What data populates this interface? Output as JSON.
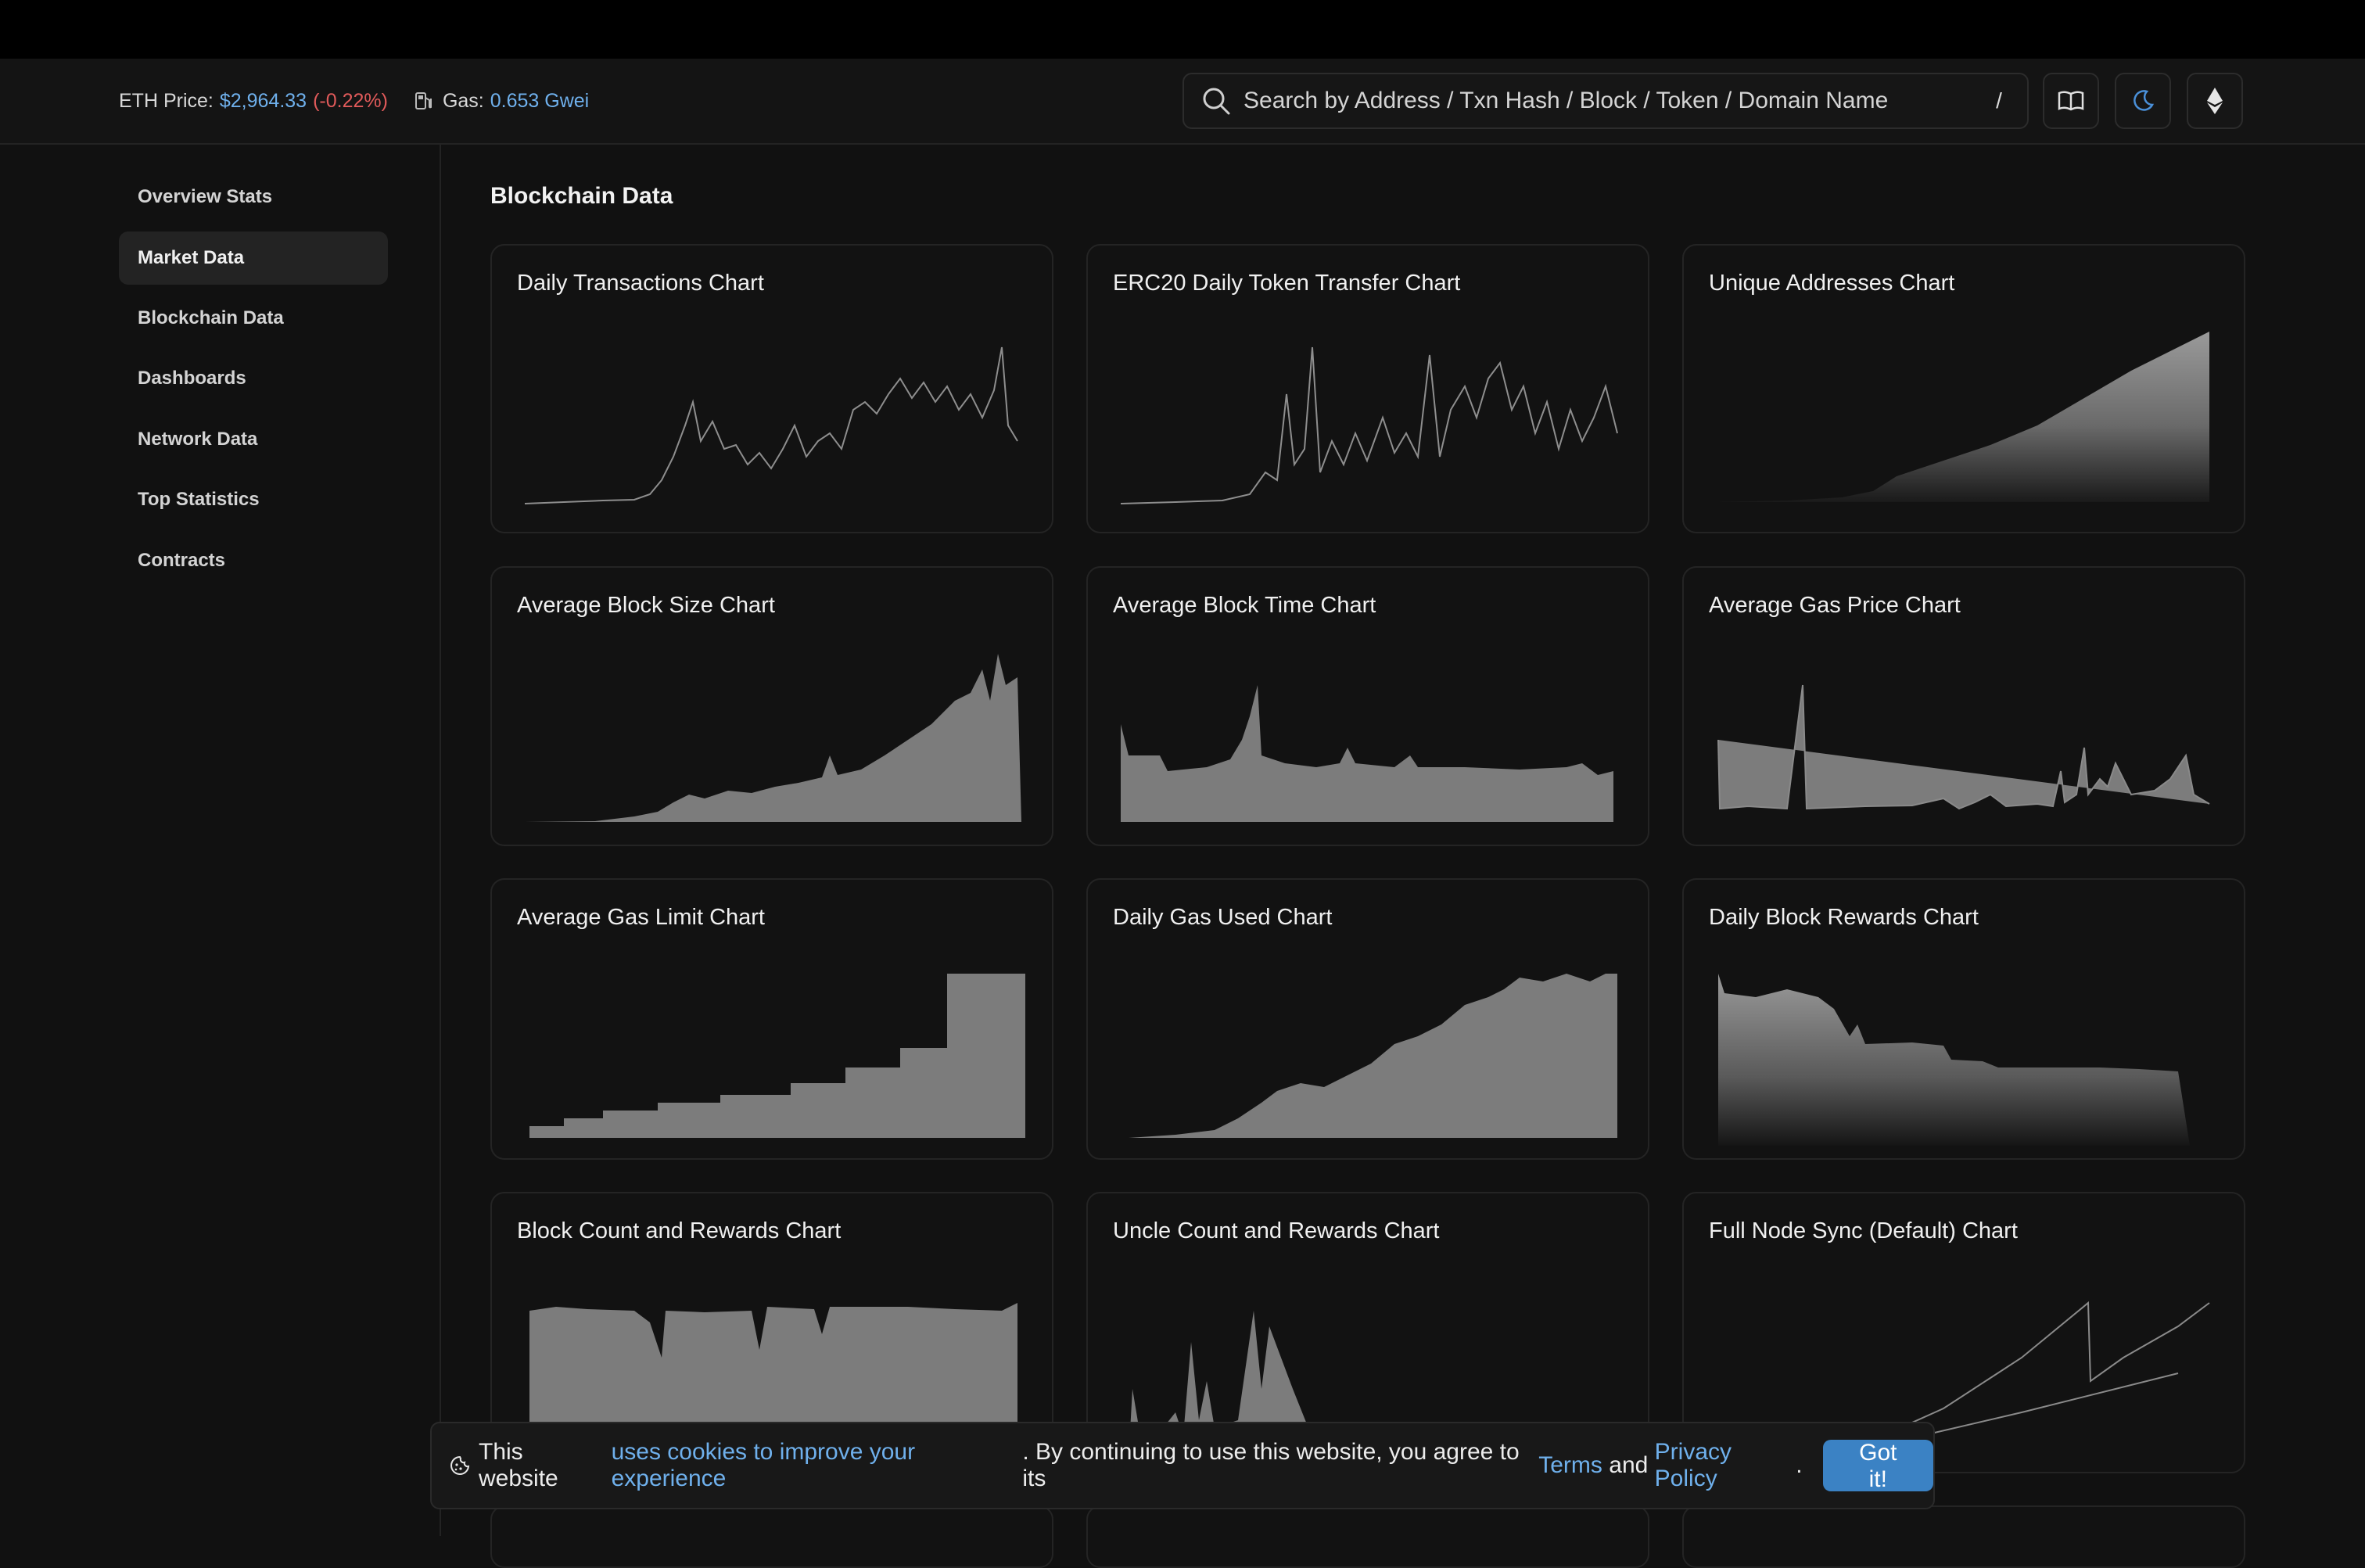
{
  "header": {
    "eth_price_label": "ETH Price:",
    "eth_price_value": "$2,964.33",
    "eth_price_change": "(-0.22%)",
    "gas_label": "Gas:",
    "gas_value": "0.653 Gwei",
    "search_placeholder": "Search by Address / Txn Hash / Block / Token / Domain Name",
    "search_shortcut": "/"
  },
  "sidebar": {
    "items": [
      {
        "label": "Overview Stats"
      },
      {
        "label": "Market Data",
        "active": true
      },
      {
        "label": "Blockchain Data"
      },
      {
        "label": "Dashboards"
      },
      {
        "label": "Network Data"
      },
      {
        "label": "Top Statistics"
      },
      {
        "label": "Contracts"
      }
    ]
  },
  "main": {
    "section_title": "Blockchain Data",
    "cards": [
      {
        "title": "Daily Transactions Chart"
      },
      {
        "title": "ERC20 Daily Token Transfer Chart"
      },
      {
        "title": "Unique Addresses Chart"
      },
      {
        "title": "Average Block Size Chart"
      },
      {
        "title": "Average Block Time Chart"
      },
      {
        "title": "Average Gas Price Chart"
      },
      {
        "title": "Average Gas Limit Chart"
      },
      {
        "title": "Daily Gas Used Chart"
      },
      {
        "title": "Daily Block Rewards Chart"
      },
      {
        "title": "Block Count and Rewards Chart"
      },
      {
        "title": "Uncle Count and Rewards Chart"
      },
      {
        "title": "Full Node Sync (Default) Chart"
      }
    ]
  },
  "cookie": {
    "text_1": "This website",
    "link_1": "uses cookies to improve your experience",
    "text_2": ". By continuing to use this website, you agree to its",
    "link_terms": "Terms",
    "text_and": "and",
    "link_privacy": "Privacy Policy",
    "text_end": ".",
    "button": "Got it!"
  },
  "colors": {
    "accent": "#6fb0ec",
    "negative": "#e05a5a",
    "button": "#3b82c4",
    "chart_fill": "#7c7c7c"
  },
  "icons": {
    "gas": "gas-pump-icon",
    "search": "search-icon",
    "reader": "book-open-icon",
    "theme": "moon-icon",
    "network": "ethereum-icon",
    "cookie": "cookie-icon"
  }
}
